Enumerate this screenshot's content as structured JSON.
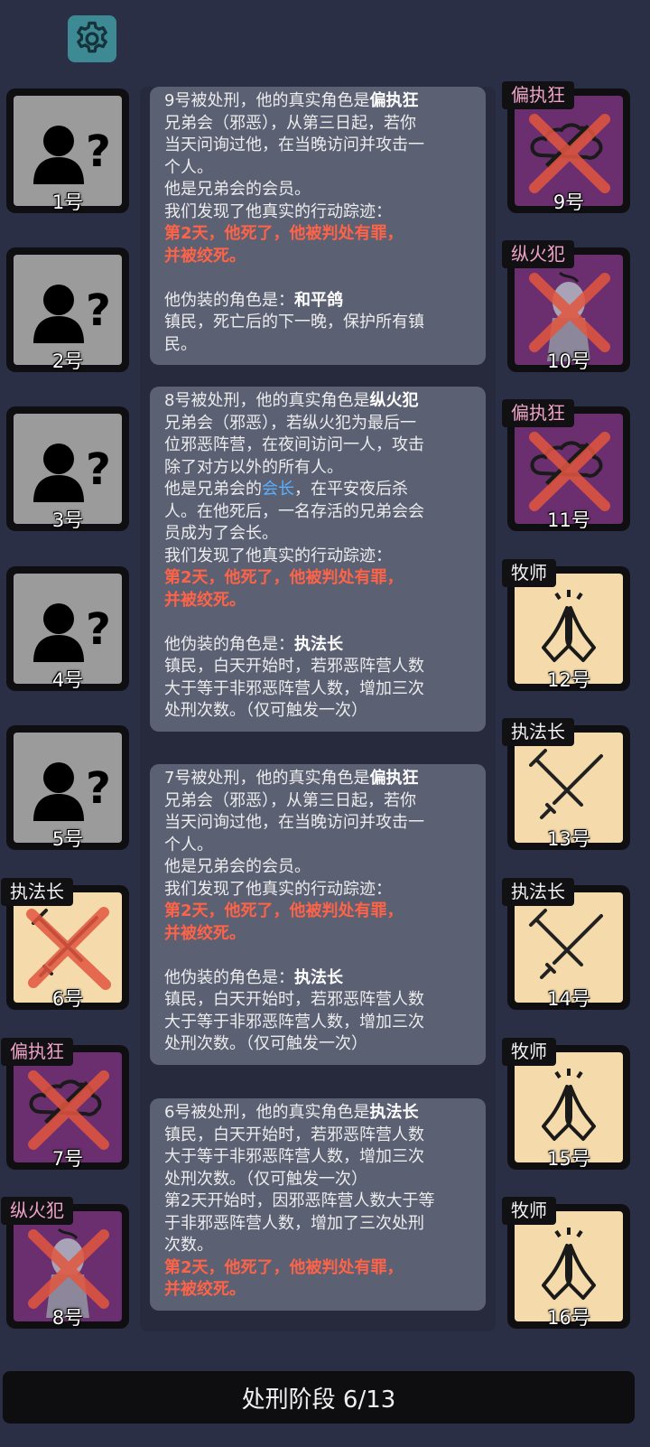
{
  "settings": {
    "icon": "gear-icon"
  },
  "left_players": [
    {
      "num": "1号",
      "tag": "",
      "state": "unknown"
    },
    {
      "num": "2号",
      "tag": "",
      "state": "unknown"
    },
    {
      "num": "3号",
      "tag": "",
      "state": "unknown"
    },
    {
      "num": "4号",
      "tag": "",
      "state": "unknown"
    },
    {
      "num": "5号",
      "tag": "",
      "state": "unknown"
    },
    {
      "num": "6号",
      "tag": "执法长",
      "state": "dead"
    },
    {
      "num": "7号",
      "tag": "偏执狂",
      "state": "dead"
    },
    {
      "num": "8号",
      "tag": "纵火犯",
      "state": "dead"
    }
  ],
  "right_players": [
    {
      "num": "9号",
      "tag": "偏执狂",
      "state": "dead"
    },
    {
      "num": "10号",
      "tag": "纵火犯",
      "state": "dead"
    },
    {
      "num": "11号",
      "tag": "偏执狂",
      "state": "dead"
    },
    {
      "num": "12号",
      "tag": "牧师",
      "state": "alive"
    },
    {
      "num": "13号",
      "tag": "执法长",
      "state": "alive"
    },
    {
      "num": "14号",
      "tag": "执法长",
      "state": "alive"
    },
    {
      "num": "15号",
      "tag": "牧师",
      "state": "alive"
    },
    {
      "num": "16号",
      "tag": "牧师",
      "state": "alive"
    }
  ],
  "log": {
    "c1": {
      "l1a": "9号被处刑，他的真实角色是",
      "l1b": "偏执狂",
      "l2": "兄弟会（邪恶），从第三日起，若你",
      "l3": "当天问询过他，在当晚访问并攻击一",
      "l4": "个人。",
      "l5": "他是兄弟会的会员。",
      "l6": "我们发现了他真实的行动踪迹：",
      "l7": "第2天，他死了，他被判处有罪，",
      "l8": "并被绞死。",
      "l9a": "他伪装的角色是：",
      "l9b": "和平鸽",
      "l10": "镇民，死亡后的下一晚，保护所有镇",
      "l11": "民。"
    },
    "c2": {
      "l1a": "8号被处刑，他的真实角色是",
      "l1b": "纵火犯",
      "l2": "兄弟会（邪恶），若纵火犯为最后一",
      "l3": "位邪恶阵营，在夜间访问一人，攻击",
      "l4": "除了对方以外的所有人。",
      "l5a": "他是兄弟会的",
      "l5b": "会长",
      "l5c": "，在平安夜后杀",
      "l6": "人。在他死后，一名存活的兄弟会会",
      "l7": "员成为了会长。",
      "l8": "我们发现了他真实的行动踪迹：",
      "l9": "第2天，他死了，他被判处有罪，",
      "l10": "并被绞死。",
      "l11a": "他伪装的角色是：",
      "l11b": "执法长",
      "l12": "镇民，白天开始时，若邪恶阵营人数",
      "l13": "大于等于非邪恶阵营人数，增加三次",
      "l14": "处刑次数。（仅可触发一次）"
    },
    "c3": {
      "l1a": "7号被处刑，他的真实角色是",
      "l1b": "偏执狂",
      "l2": "兄弟会（邪恶），从第三日起，若你",
      "l3": "当天问询过他，在当晚访问并攻击一",
      "l4": "个人。",
      "l5": "他是兄弟会的会员。",
      "l6": "我们发现了他真实的行动踪迹：",
      "l7": "第2天，他死了，他被判处有罪，",
      "l8": "并被绞死。",
      "l9a": "他伪装的角色是：",
      "l9b": "执法长",
      "l10": "镇民，白天开始时，若邪恶阵营人数",
      "l11": "大于等于非邪恶阵营人数，增加三次",
      "l12": "处刑次数。（仅可触发一次）"
    },
    "c4": {
      "l1a": "6号被处刑，他的真实角色是",
      "l1b": "执法长",
      "l2": "镇民，白天开始时，若邪恶阵营人数",
      "l3": "大于等于非邪恶阵营人数，增加三次",
      "l4": "处刑次数。（仅可触发一次）",
      "l5": "第2天开始时，因邪恶阵营人数大于等",
      "l6": "于非邪恶阵营人数，增加了三次处刑",
      "l7": "次数。",
      "l8": "第2天，他死了，他被判处有罪，",
      "l9": "并被绞死。"
    }
  },
  "phase": {
    "label": "处刑阶段 6/13",
    "current": 6,
    "total": 13
  },
  "colors": {
    "background": "#2b2f46",
    "card": "#5b6073",
    "red_text": "#ff6347",
    "link_blue": "#5ab0ff",
    "unknown_face": "#9b9b9b",
    "evil_face": "#6b2f6f",
    "town_face": "#f5dbac"
  }
}
